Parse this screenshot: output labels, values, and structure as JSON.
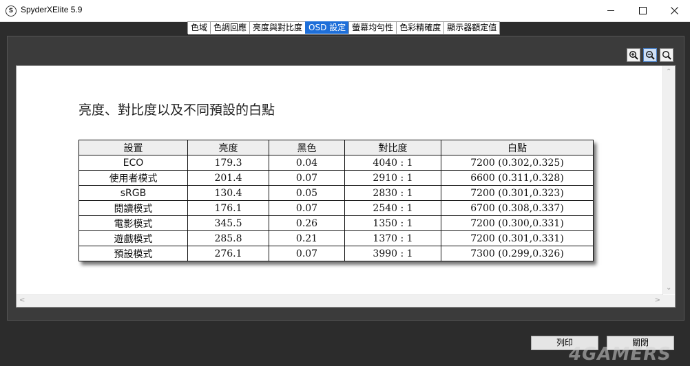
{
  "window": {
    "title": "SpyderXElite 5.9",
    "icon_letter": "S"
  },
  "tabs": [
    {
      "label": "色域",
      "active": false
    },
    {
      "label": "色調回應",
      "active": false
    },
    {
      "label": "亮度與對比度",
      "active": false
    },
    {
      "label": "OSD 設定",
      "active": true
    },
    {
      "label": "螢幕均勻性",
      "active": false
    },
    {
      "label": "色彩精確度",
      "active": false
    },
    {
      "label": "顯示器額定值",
      "active": false
    }
  ],
  "report": {
    "title": "亮度、對比度以及不同預設的白點",
    "columns": [
      "設置",
      "亮度",
      "黑色",
      "對比度",
      "白點"
    ],
    "rows": [
      [
        "ECO",
        "179.3",
        "0.04",
        "4040 : 1",
        "7200 (0.302,0.325)"
      ],
      [
        "使用者模式",
        "201.4",
        "0.07",
        "2910 : 1",
        "6600 (0.311,0.328)"
      ],
      [
        "sRGB",
        "130.4",
        "0.05",
        "2830 : 1",
        "7200 (0.301,0.323)"
      ],
      [
        "閱讀模式",
        "176.1",
        "0.07",
        "2540 : 1",
        "6700 (0.308,0.337)"
      ],
      [
        "電影模式",
        "345.5",
        "0.26",
        "1350 : 1",
        "7200 (0.300,0.331)"
      ],
      [
        "遊戲模式",
        "285.8",
        "0.21",
        "1370 : 1",
        "7200 (0.301,0.331)"
      ],
      [
        "預設模式",
        "276.1",
        "0.07",
        "3990 : 1",
        "7300 (0.299,0.326)"
      ]
    ]
  },
  "buttons": {
    "print": "列印",
    "close": "關閉"
  },
  "watermark": "4GAMERS",
  "colors": {
    "active_tab": "#1e6fd9",
    "background": "#2c2c2c"
  }
}
